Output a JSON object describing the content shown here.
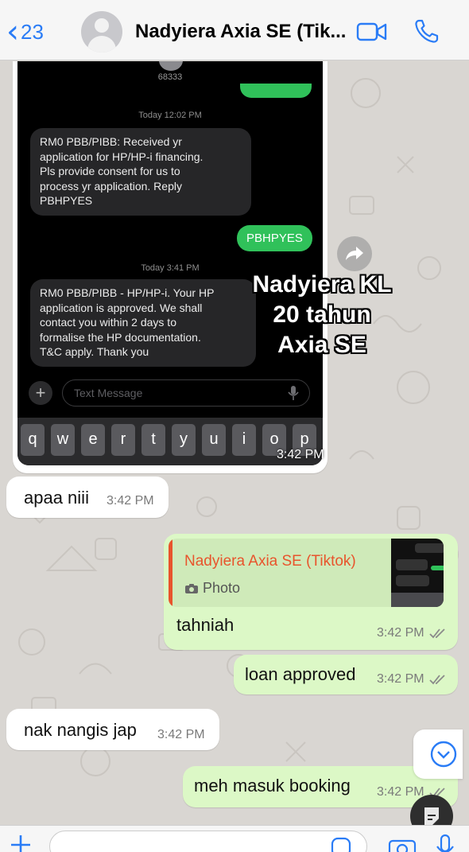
{
  "header": {
    "back_count": "23",
    "title": "Nadyiera Axia SE (Tik..."
  },
  "image_message": {
    "sms_sender": "68333",
    "sms_messages": [
      {
        "type": "time",
        "text": "Today 12:02 PM"
      },
      {
        "type": "in",
        "text": "RM0 PBB/PIBB: Received yr\napplication for HP/HP-i financing.\nPls provide consent for us to\nprocess yr application. Reply\nPBHPYES"
      },
      {
        "type": "out",
        "text": "PBHPYES"
      },
      {
        "type": "time",
        "text": "Today 3:41 PM"
      },
      {
        "type": "in",
        "text": "RM0 PBB/PIBB - HP/HP-i. Your HP\napplication is approved. We shall\ncontact you within 2 days to\nformalise the HP documentation.\nT&C apply. Thank you"
      }
    ],
    "input_placeholder": "Text Message",
    "keyboard_keys": [
      "q",
      "w",
      "e",
      "r",
      "t",
      "y",
      "u",
      "i",
      "o",
      "p"
    ],
    "overlay_lines": [
      "Nadyiera KL",
      "20 tahun",
      "Axia SE"
    ],
    "time": "3:42 PM"
  },
  "messages": [
    {
      "direction": "in",
      "text": "apaa niii",
      "time": "3:42 PM"
    },
    {
      "direction": "out",
      "quote_name": "Nadyiera Axia SE (Tiktok)",
      "quote_type": "Photo",
      "text": "tahniah",
      "time": "3:42 PM"
    },
    {
      "direction": "out",
      "text": "loan approved",
      "time": "3:42 PM"
    },
    {
      "direction": "in",
      "text": "nak nangis jap",
      "time": "3:42 PM"
    },
    {
      "direction": "out",
      "text": "meh masuk booking",
      "time": "3:42 PM"
    }
  ],
  "colors": {
    "accent": "#2a7cf6",
    "outgoing_bubble": "#dcf8c6",
    "incoming_bubble": "#ffffff",
    "quote_name": "#e8542c",
    "sms_green": "#30c15a"
  }
}
